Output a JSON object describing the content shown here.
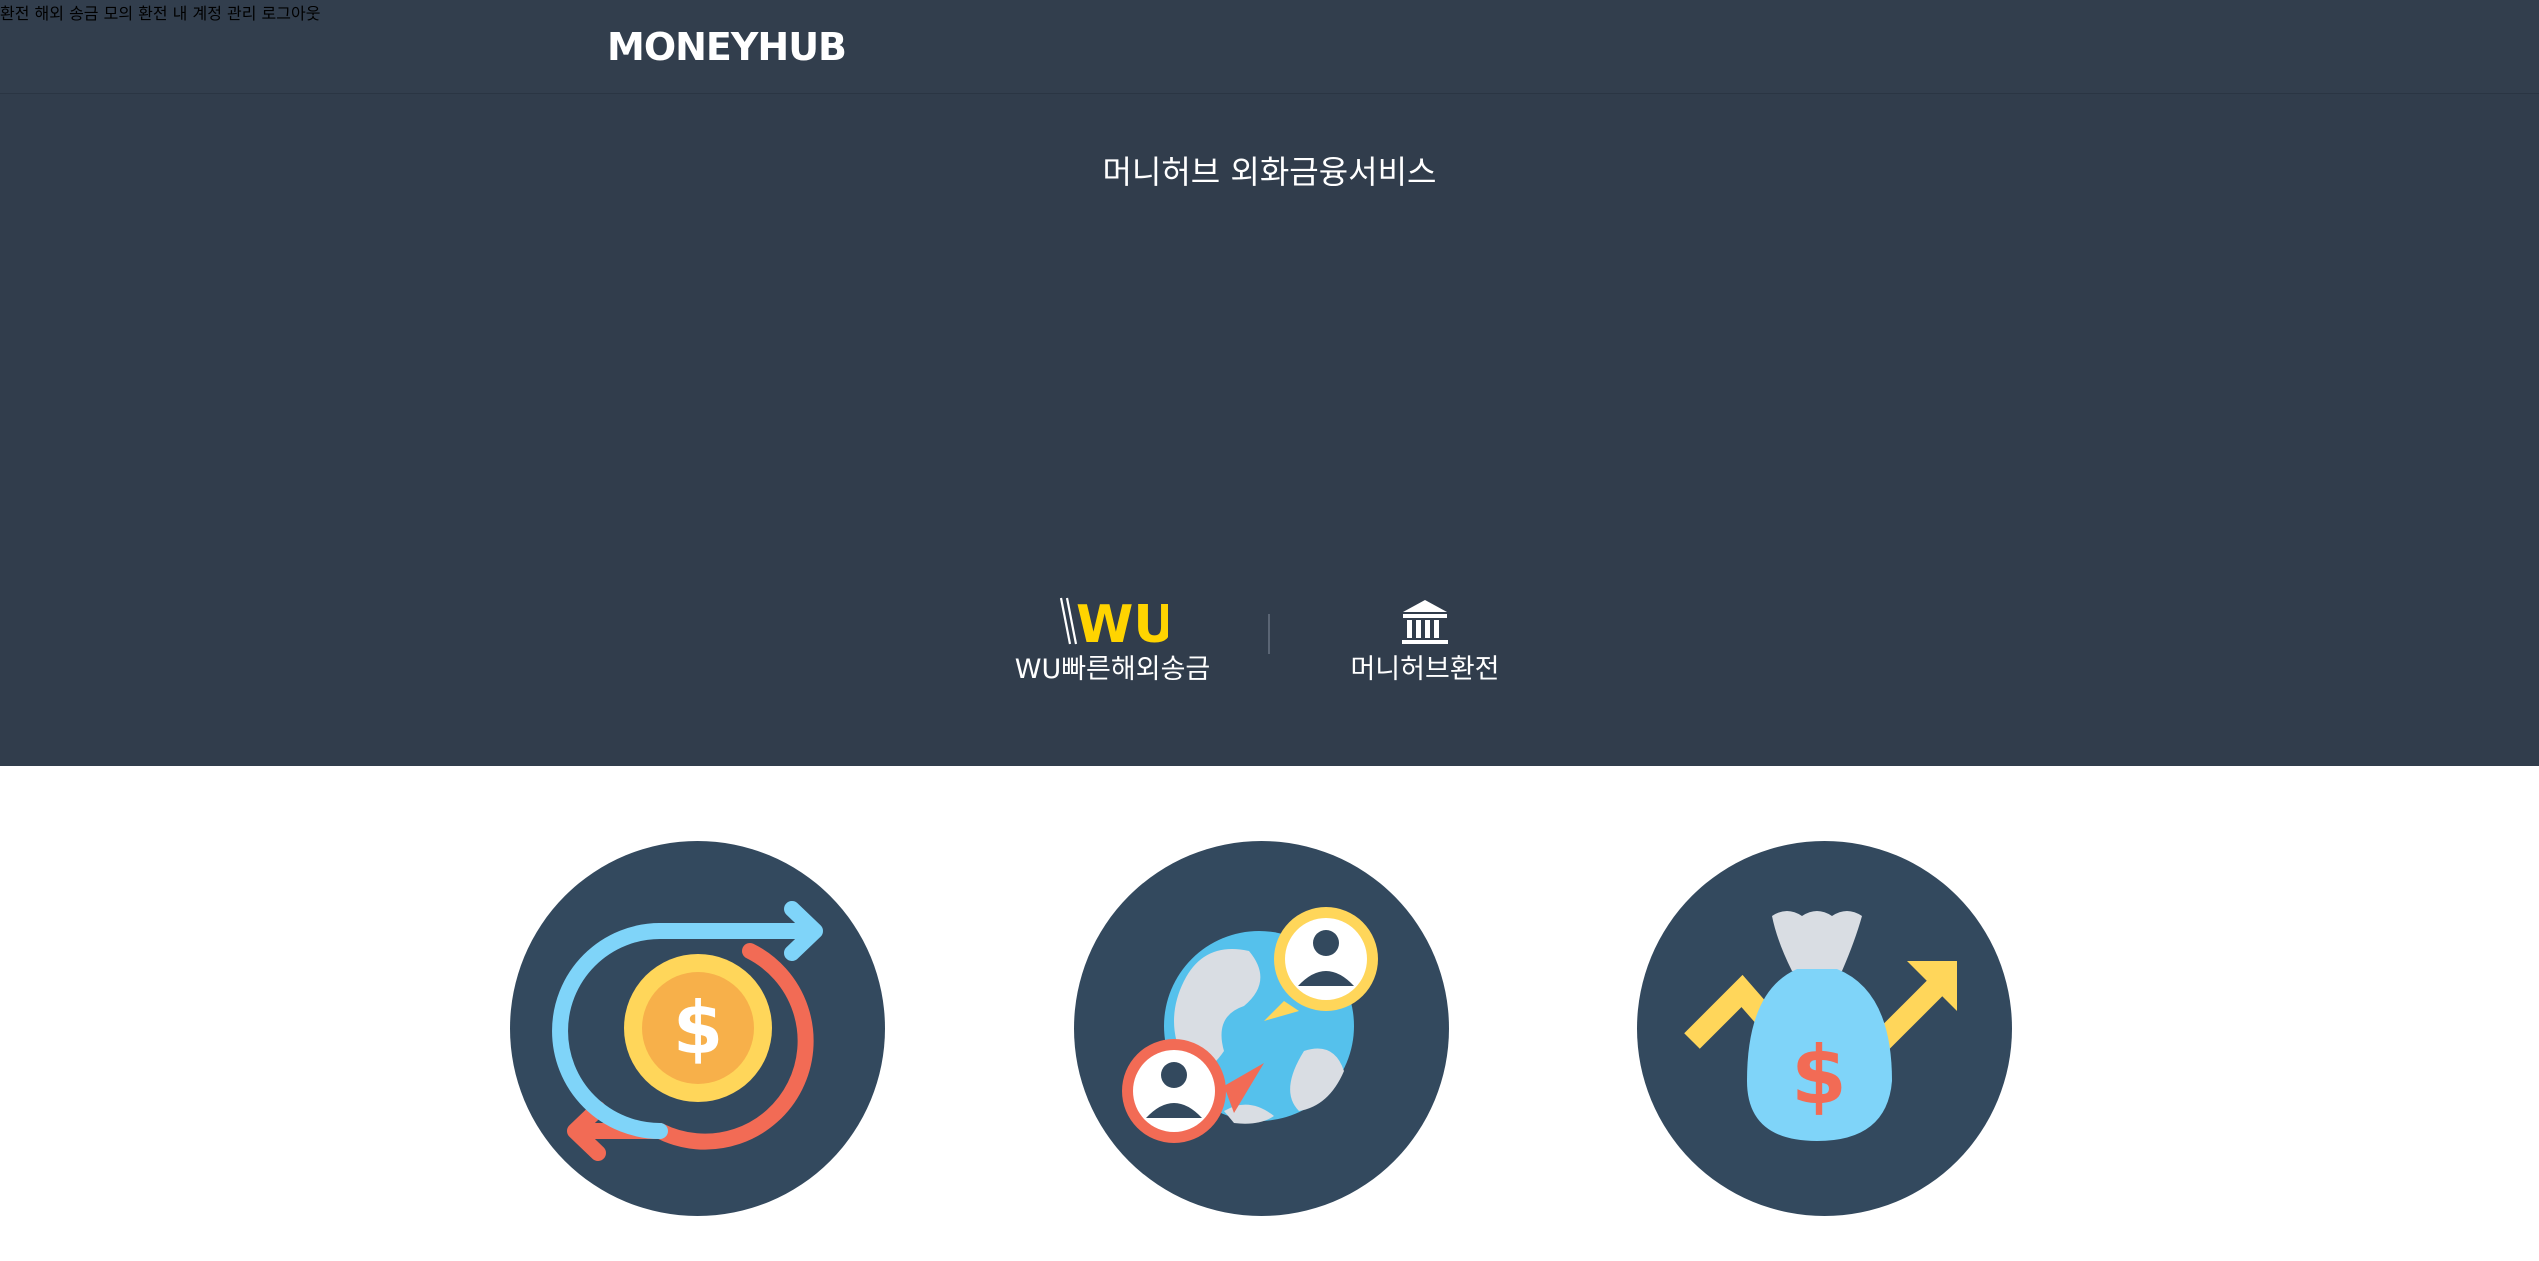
{
  "header": {
    "logo_text": "MONEYHUB",
    "nav": [
      {
        "label": "환전"
      },
      {
        "label": "해외 송금"
      },
      {
        "label": "모의 환전"
      },
      {
        "label": "내 계정 관리"
      },
      {
        "label": "로그아웃"
      }
    ]
  },
  "hero": {
    "title": "머니허브 외화금융서비스",
    "services": [
      {
        "label": "WU빠른해외송금",
        "logo_text": "WU",
        "icon": "western-union-logo"
      },
      {
        "label": "머니허브환전",
        "icon": "bank-icon"
      }
    ]
  },
  "features": [
    {
      "icon": "currency-exchange-icon"
    },
    {
      "icon": "global-transfer-icon"
    },
    {
      "icon": "money-bag-growth-icon"
    }
  ],
  "colors": {
    "hero_bg": "#313d4c",
    "circle_bg": "#33495e",
    "accent_yellow": "#ffd400",
    "accent_blue": "#7fd4f9",
    "accent_red": "#f26b55"
  }
}
